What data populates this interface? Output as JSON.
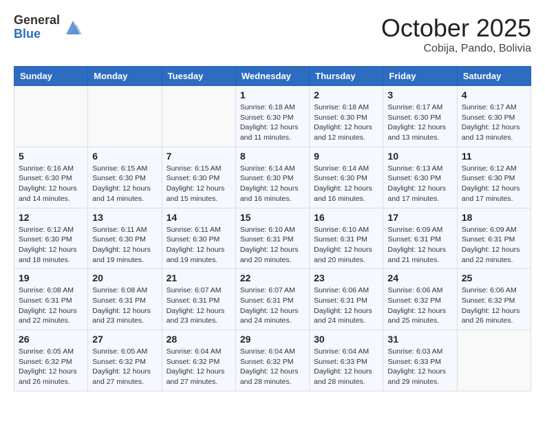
{
  "header": {
    "logo_general": "General",
    "logo_blue": "Blue",
    "month": "October 2025",
    "location": "Cobija, Pando, Bolivia"
  },
  "weekdays": [
    "Sunday",
    "Monday",
    "Tuesday",
    "Wednesday",
    "Thursday",
    "Friday",
    "Saturday"
  ],
  "weeks": [
    [
      {
        "day": "",
        "info": ""
      },
      {
        "day": "",
        "info": ""
      },
      {
        "day": "",
        "info": ""
      },
      {
        "day": "1",
        "info": "Sunrise: 6:18 AM\nSunset: 6:30 PM\nDaylight: 12 hours\nand 11 minutes."
      },
      {
        "day": "2",
        "info": "Sunrise: 6:18 AM\nSunset: 6:30 PM\nDaylight: 12 hours\nand 12 minutes."
      },
      {
        "day": "3",
        "info": "Sunrise: 6:17 AM\nSunset: 6:30 PM\nDaylight: 12 hours\nand 13 minutes."
      },
      {
        "day": "4",
        "info": "Sunrise: 6:17 AM\nSunset: 6:30 PM\nDaylight: 12 hours\nand 13 minutes."
      }
    ],
    [
      {
        "day": "5",
        "info": "Sunrise: 6:16 AM\nSunset: 6:30 PM\nDaylight: 12 hours\nand 14 minutes."
      },
      {
        "day": "6",
        "info": "Sunrise: 6:15 AM\nSunset: 6:30 PM\nDaylight: 12 hours\nand 14 minutes."
      },
      {
        "day": "7",
        "info": "Sunrise: 6:15 AM\nSunset: 6:30 PM\nDaylight: 12 hours\nand 15 minutes."
      },
      {
        "day": "8",
        "info": "Sunrise: 6:14 AM\nSunset: 6:30 PM\nDaylight: 12 hours\nand 16 minutes."
      },
      {
        "day": "9",
        "info": "Sunrise: 6:14 AM\nSunset: 6:30 PM\nDaylight: 12 hours\nand 16 minutes."
      },
      {
        "day": "10",
        "info": "Sunrise: 6:13 AM\nSunset: 6:30 PM\nDaylight: 12 hours\nand 17 minutes."
      },
      {
        "day": "11",
        "info": "Sunrise: 6:12 AM\nSunset: 6:30 PM\nDaylight: 12 hours\nand 17 minutes."
      }
    ],
    [
      {
        "day": "12",
        "info": "Sunrise: 6:12 AM\nSunset: 6:30 PM\nDaylight: 12 hours\nand 18 minutes."
      },
      {
        "day": "13",
        "info": "Sunrise: 6:11 AM\nSunset: 6:30 PM\nDaylight: 12 hours\nand 19 minutes."
      },
      {
        "day": "14",
        "info": "Sunrise: 6:11 AM\nSunset: 6:30 PM\nDaylight: 12 hours\nand 19 minutes."
      },
      {
        "day": "15",
        "info": "Sunrise: 6:10 AM\nSunset: 6:31 PM\nDaylight: 12 hours\nand 20 minutes."
      },
      {
        "day": "16",
        "info": "Sunrise: 6:10 AM\nSunset: 6:31 PM\nDaylight: 12 hours\nand 20 minutes."
      },
      {
        "day": "17",
        "info": "Sunrise: 6:09 AM\nSunset: 6:31 PM\nDaylight: 12 hours\nand 21 minutes."
      },
      {
        "day": "18",
        "info": "Sunrise: 6:09 AM\nSunset: 6:31 PM\nDaylight: 12 hours\nand 22 minutes."
      }
    ],
    [
      {
        "day": "19",
        "info": "Sunrise: 6:08 AM\nSunset: 6:31 PM\nDaylight: 12 hours\nand 22 minutes."
      },
      {
        "day": "20",
        "info": "Sunrise: 6:08 AM\nSunset: 6:31 PM\nDaylight: 12 hours\nand 23 minutes."
      },
      {
        "day": "21",
        "info": "Sunrise: 6:07 AM\nSunset: 6:31 PM\nDaylight: 12 hours\nand 23 minutes."
      },
      {
        "day": "22",
        "info": "Sunrise: 6:07 AM\nSunset: 6:31 PM\nDaylight: 12 hours\nand 24 minutes."
      },
      {
        "day": "23",
        "info": "Sunrise: 6:06 AM\nSunset: 6:31 PM\nDaylight: 12 hours\nand 24 minutes."
      },
      {
        "day": "24",
        "info": "Sunrise: 6:06 AM\nSunset: 6:32 PM\nDaylight: 12 hours\nand 25 minutes."
      },
      {
        "day": "25",
        "info": "Sunrise: 6:06 AM\nSunset: 6:32 PM\nDaylight: 12 hours\nand 26 minutes."
      }
    ],
    [
      {
        "day": "26",
        "info": "Sunrise: 6:05 AM\nSunset: 6:32 PM\nDaylight: 12 hours\nand 26 minutes."
      },
      {
        "day": "27",
        "info": "Sunrise: 6:05 AM\nSunset: 6:32 PM\nDaylight: 12 hours\nand 27 minutes."
      },
      {
        "day": "28",
        "info": "Sunrise: 6:04 AM\nSunset: 6:32 PM\nDaylight: 12 hours\nand 27 minutes."
      },
      {
        "day": "29",
        "info": "Sunrise: 6:04 AM\nSunset: 6:32 PM\nDaylight: 12 hours\nand 28 minutes."
      },
      {
        "day": "30",
        "info": "Sunrise: 6:04 AM\nSunset: 6:33 PM\nDaylight: 12 hours\nand 28 minutes."
      },
      {
        "day": "31",
        "info": "Sunrise: 6:03 AM\nSunset: 6:33 PM\nDaylight: 12 hours\nand 29 minutes."
      },
      {
        "day": "",
        "info": ""
      }
    ]
  ]
}
